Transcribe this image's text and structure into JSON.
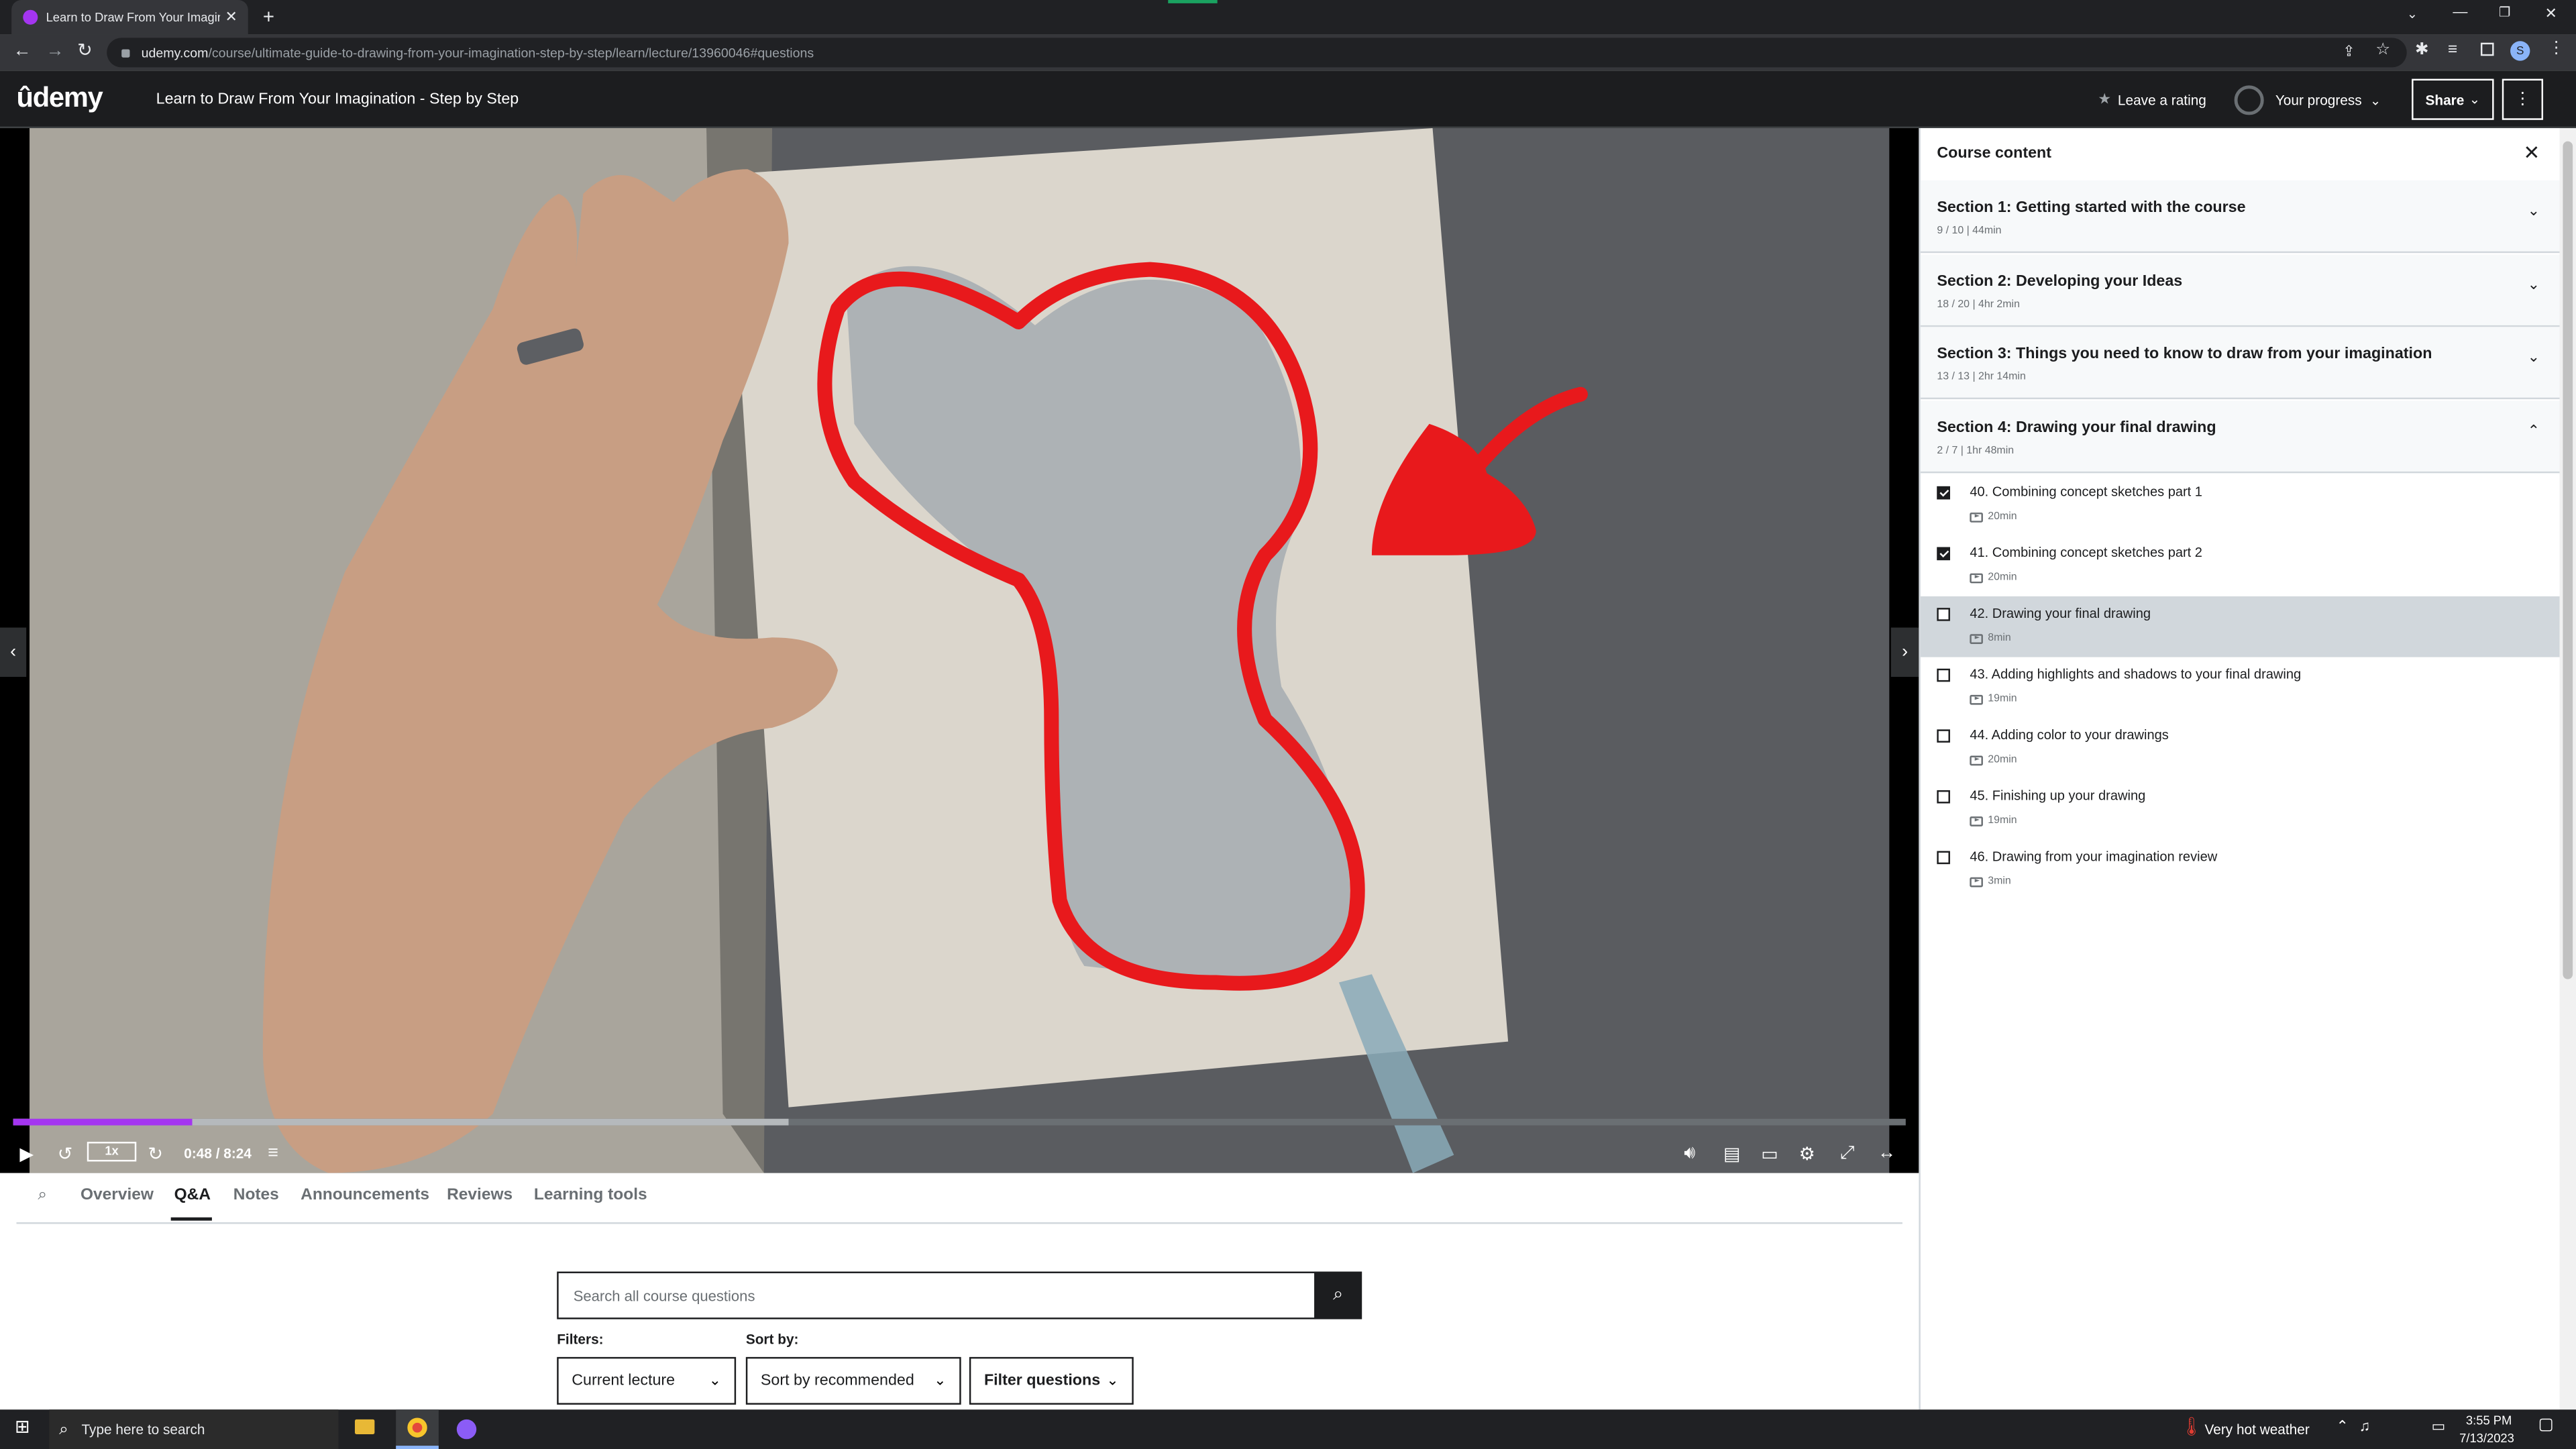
{
  "browser": {
    "tab_title": "Learn to Draw From Your Imagina",
    "url_domain": "udemy.com",
    "url_path": "/course/ultimate-guide-to-drawing-from-your-imagination-step-by-step/learn/lecture/13960046#questions"
  },
  "header": {
    "logo": "ûdemy",
    "course_title": "Learn to Draw From Your Imagination - Step by Step",
    "rating_label": "Leave a rating",
    "progress_label": "Your progress",
    "share_label": "Share"
  },
  "player": {
    "speed": "1x",
    "time": "0:48 / 8:24",
    "progress_fraction": 0.095,
    "buffered_fraction": 0.41
  },
  "course_content": {
    "title": "Course content",
    "sections": [
      {
        "title": "Section 1: Getting started with the course",
        "meta": "9 / 10 | 44min"
      },
      {
        "title": "Section 2: Developing your Ideas",
        "meta": "18 / 20 | 4hr 2min"
      },
      {
        "title": "Section 3: Things you need to know to draw from your imagination",
        "meta": "13 / 13 | 2hr 14min"
      },
      {
        "title": "Section 4: Drawing your final drawing",
        "meta": "2 / 7 | 1hr 48min"
      }
    ],
    "lectures": [
      {
        "title": "40. Combining concept sketches part 1",
        "duration": "20min",
        "done": true
      },
      {
        "title": "41. Combining concept sketches part 2",
        "duration": "20min",
        "done": true
      },
      {
        "title": "42. Drawing your final drawing",
        "duration": "8min",
        "done": false
      },
      {
        "title": "43. Adding highlights and shadows to your final drawing",
        "duration": "19min",
        "done": false
      },
      {
        "title": "44. Adding color to your drawings",
        "duration": "20min",
        "done": false
      },
      {
        "title": "45. Finishing up your drawing",
        "duration": "19min",
        "done": false
      },
      {
        "title": "46. Drawing from your imagination review",
        "duration": "3min",
        "done": false
      }
    ]
  },
  "tabs": [
    "Overview",
    "Q&A",
    "Notes",
    "Announcements",
    "Reviews",
    "Learning tools"
  ],
  "qa": {
    "search_placeholder": "Search all course questions",
    "filters_label": "Filters:",
    "sort_label": "Sort by:",
    "filter_value": "Current lecture",
    "sort_value": "Sort by recommended",
    "filter_questions": "Filter questions"
  },
  "taskbar": {
    "search_placeholder": "Type here to search",
    "weather": "Very hot weather",
    "time": "3:55 PM",
    "date": "7/13/2023"
  },
  "colors": {
    "accent": "#a435f0",
    "header_bg": "#1c1d1f",
    "annotation_red": "#e8191c"
  }
}
